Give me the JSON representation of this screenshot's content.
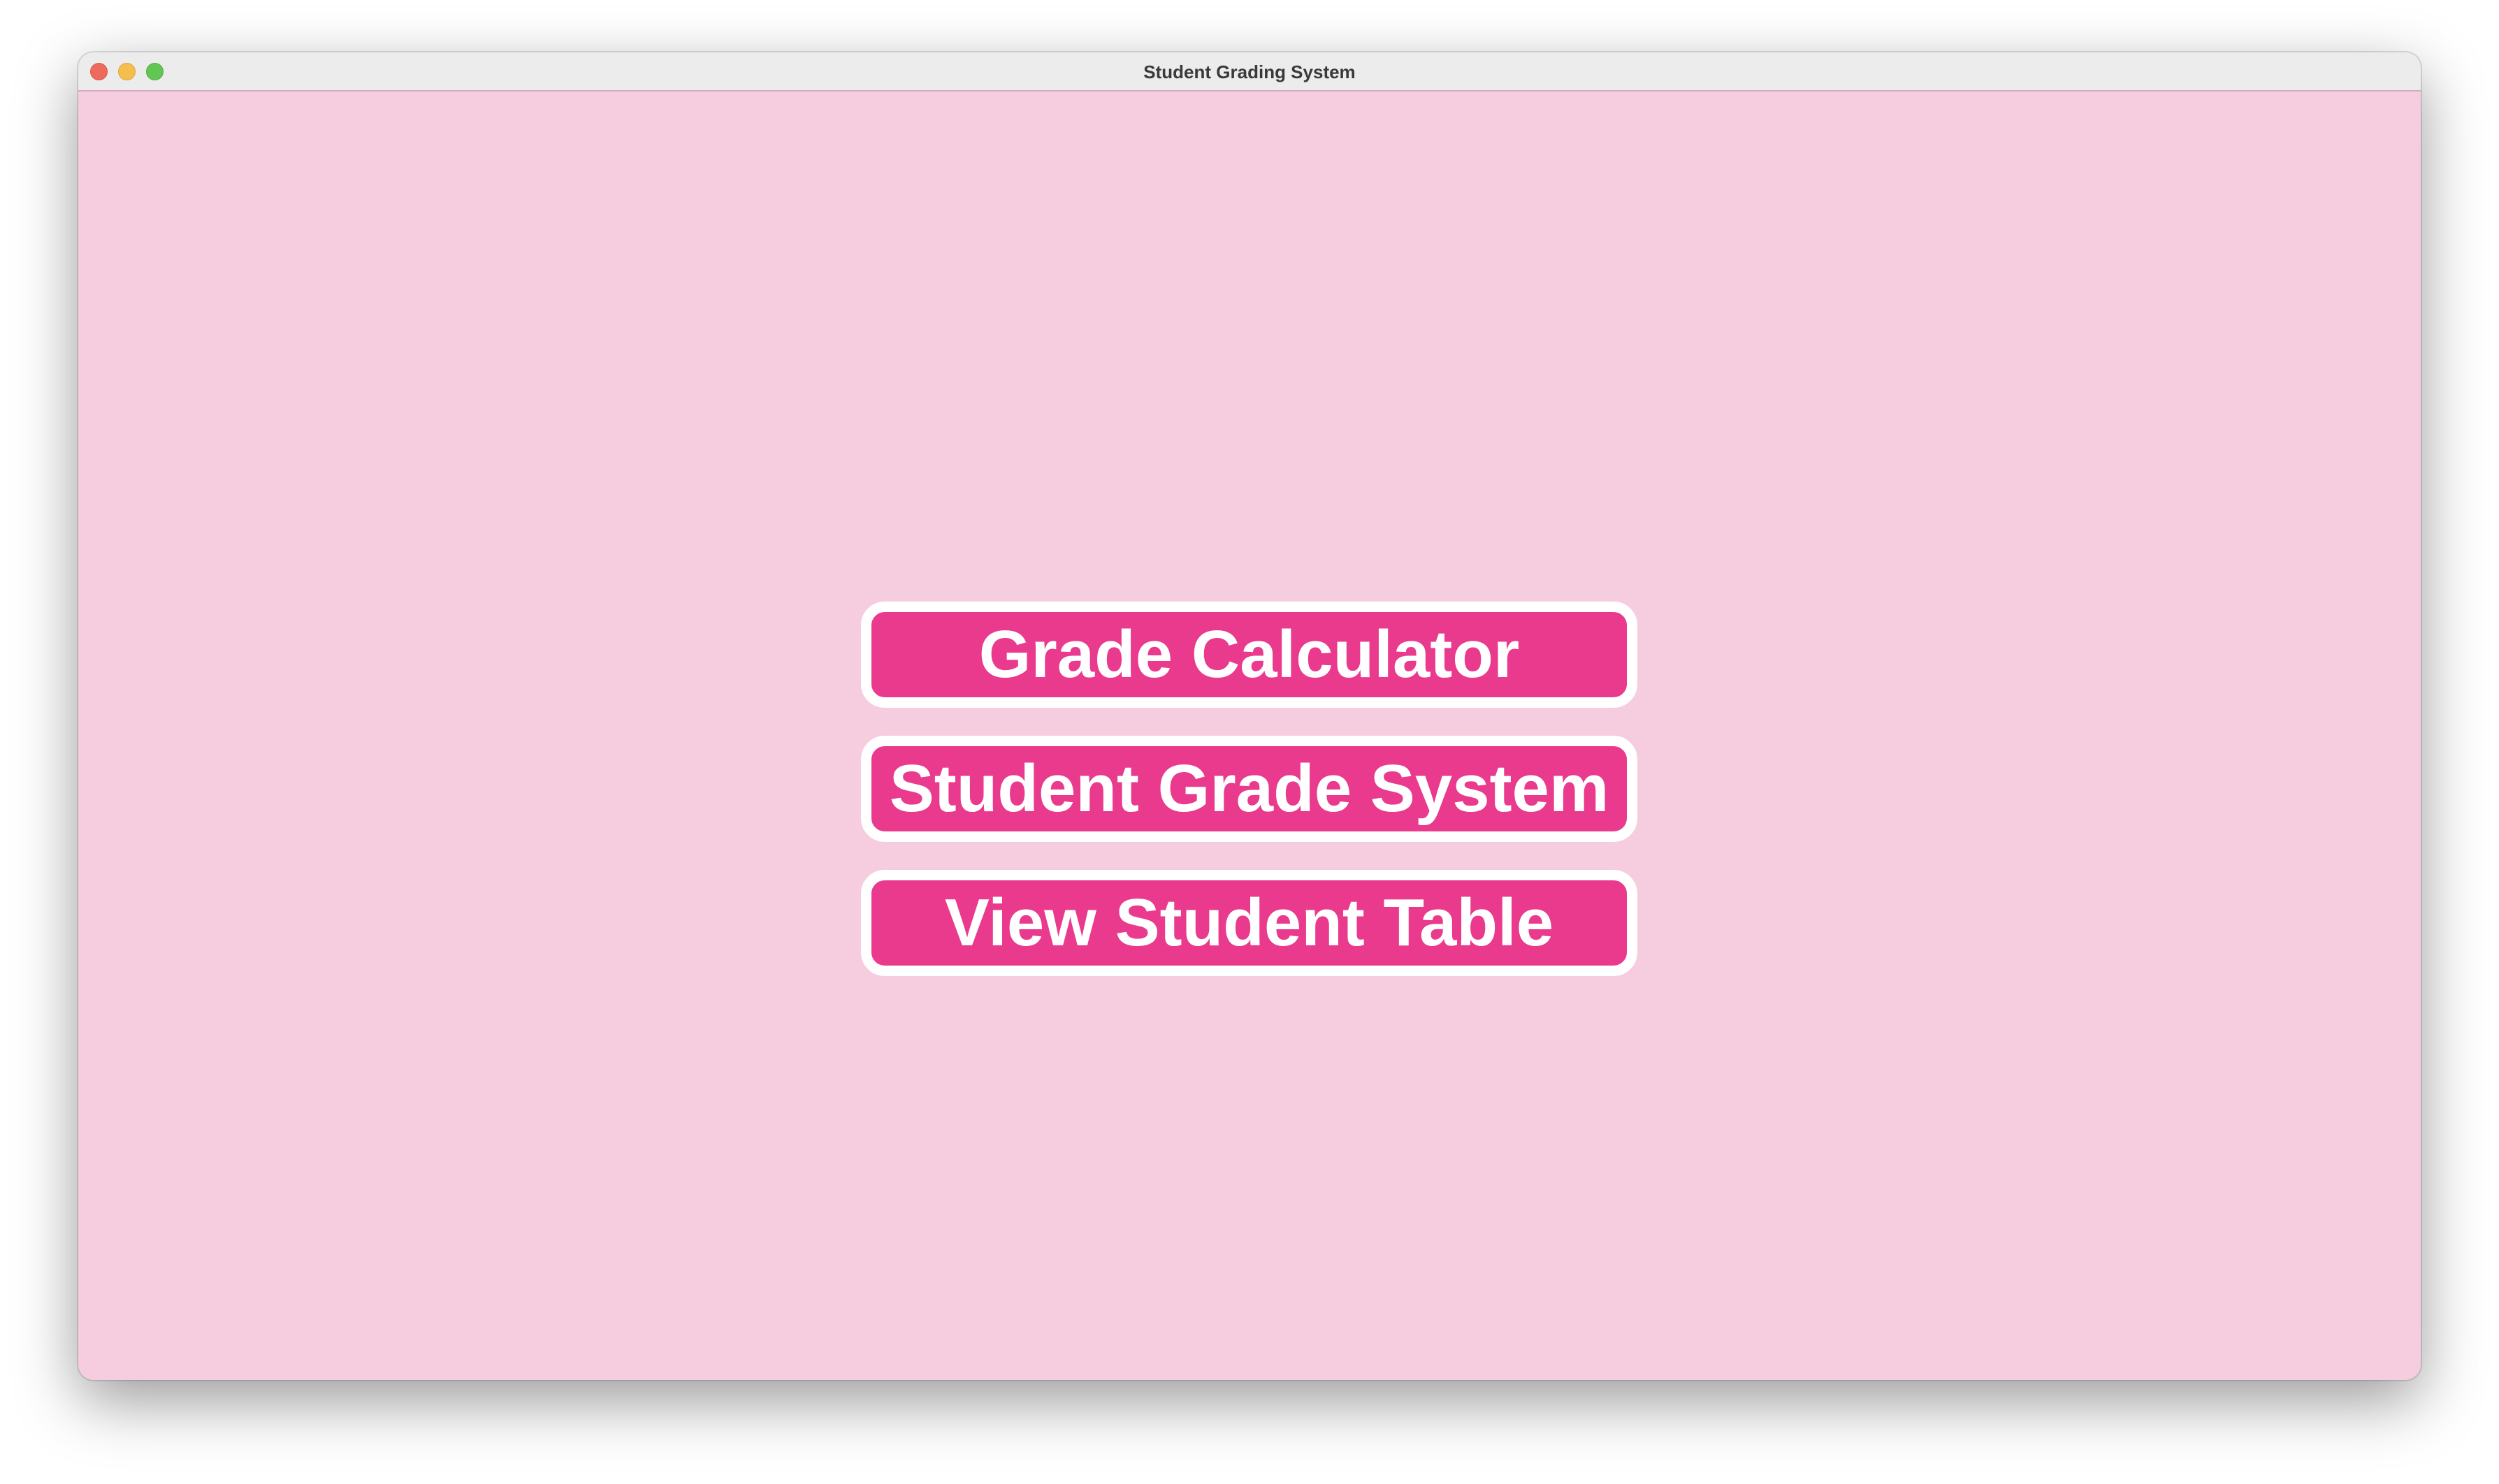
{
  "window": {
    "title": "Student Grading System"
  },
  "menu": {
    "buttons": [
      {
        "label": "Grade Calculator"
      },
      {
        "label": "Student Grade System"
      },
      {
        "label": "View Student Table"
      }
    ]
  },
  "colors": {
    "background": "#f6cddf",
    "button_fill": "#e93a8d",
    "button_border": "#ffffff",
    "button_text": "#ffffff"
  }
}
